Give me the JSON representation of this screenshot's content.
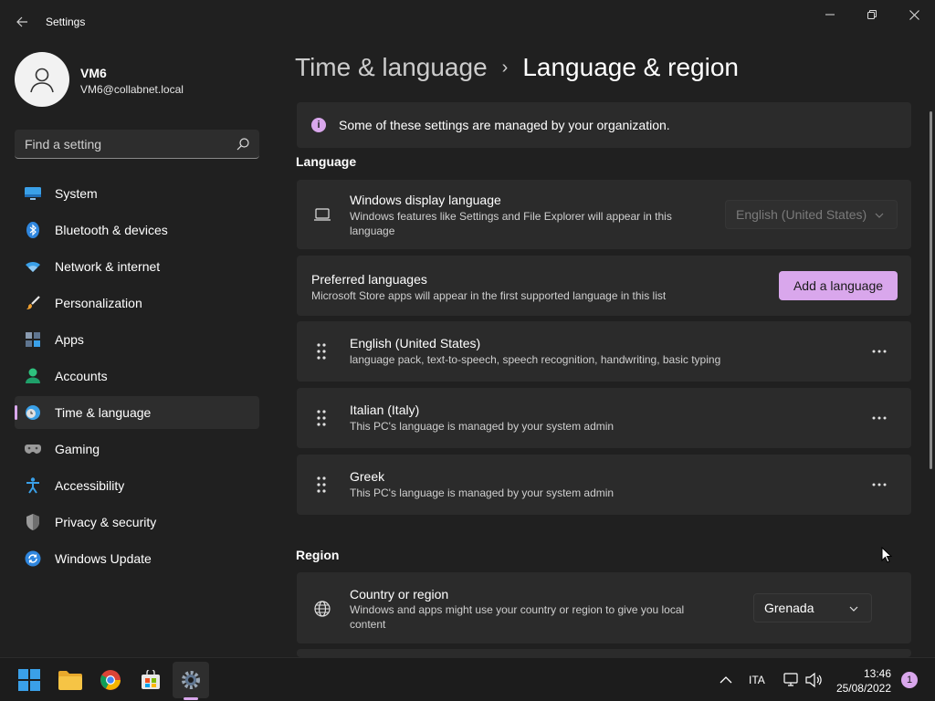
{
  "window": {
    "title": "Settings"
  },
  "user": {
    "name": "VM6",
    "email": "VM6@collabnet.local"
  },
  "search": {
    "placeholder": "Find a setting"
  },
  "sidebar": {
    "items": [
      {
        "label": "System",
        "icon": "monitor-icon"
      },
      {
        "label": "Bluetooth & devices",
        "icon": "bluetooth-icon"
      },
      {
        "label": "Network & internet",
        "icon": "wifi-icon"
      },
      {
        "label": "Personalization",
        "icon": "brush-icon"
      },
      {
        "label": "Apps",
        "icon": "apps-icon"
      },
      {
        "label": "Accounts",
        "icon": "person-icon"
      },
      {
        "label": "Time & language",
        "icon": "clock-globe-icon",
        "active": true
      },
      {
        "label": "Gaming",
        "icon": "gamepad-icon"
      },
      {
        "label": "Accessibility",
        "icon": "accessibility-icon"
      },
      {
        "label": "Privacy & security",
        "icon": "shield-icon"
      },
      {
        "label": "Windows Update",
        "icon": "update-icon"
      }
    ]
  },
  "breadcrumb": {
    "parent": "Time & language",
    "separator": "›",
    "current": "Language & region"
  },
  "banner": {
    "text": "Some of these settings are managed by your organization."
  },
  "language": {
    "section_title": "Language",
    "display_language": {
      "title": "Windows display language",
      "description": "Windows features like Settings and File Explorer will appear in this language",
      "value": "English (United States)"
    },
    "preferred": {
      "title": "Preferred languages",
      "description": "Microsoft Store apps will appear in the first supported language in this list",
      "add_button": "Add a language"
    },
    "list": [
      {
        "name": "English (United States)",
        "detail": "language pack, text-to-speech, speech recognition, handwriting, basic typing"
      },
      {
        "name": "Italian (Italy)",
        "detail": "This PC's language is managed by your system admin"
      },
      {
        "name": "Greek",
        "detail": "This PC's language is managed by your system admin"
      }
    ],
    "more_label": "···"
  },
  "region": {
    "section_title": "Region",
    "country": {
      "title": "Country or region",
      "description": "Windows and apps might use your country or region to give you local content",
      "value": "Grenada"
    }
  },
  "taskbar": {
    "apps": [
      "start-icon",
      "file-explorer-icon",
      "chrome-icon",
      "store-icon",
      "settings-icon"
    ],
    "input_language": "ITA",
    "time": "13:46",
    "date": "25/08/2022",
    "notifications": "1"
  },
  "colors": {
    "accent": "#d9a7ec",
    "background": "#202020",
    "card": "#2b2b2b"
  }
}
